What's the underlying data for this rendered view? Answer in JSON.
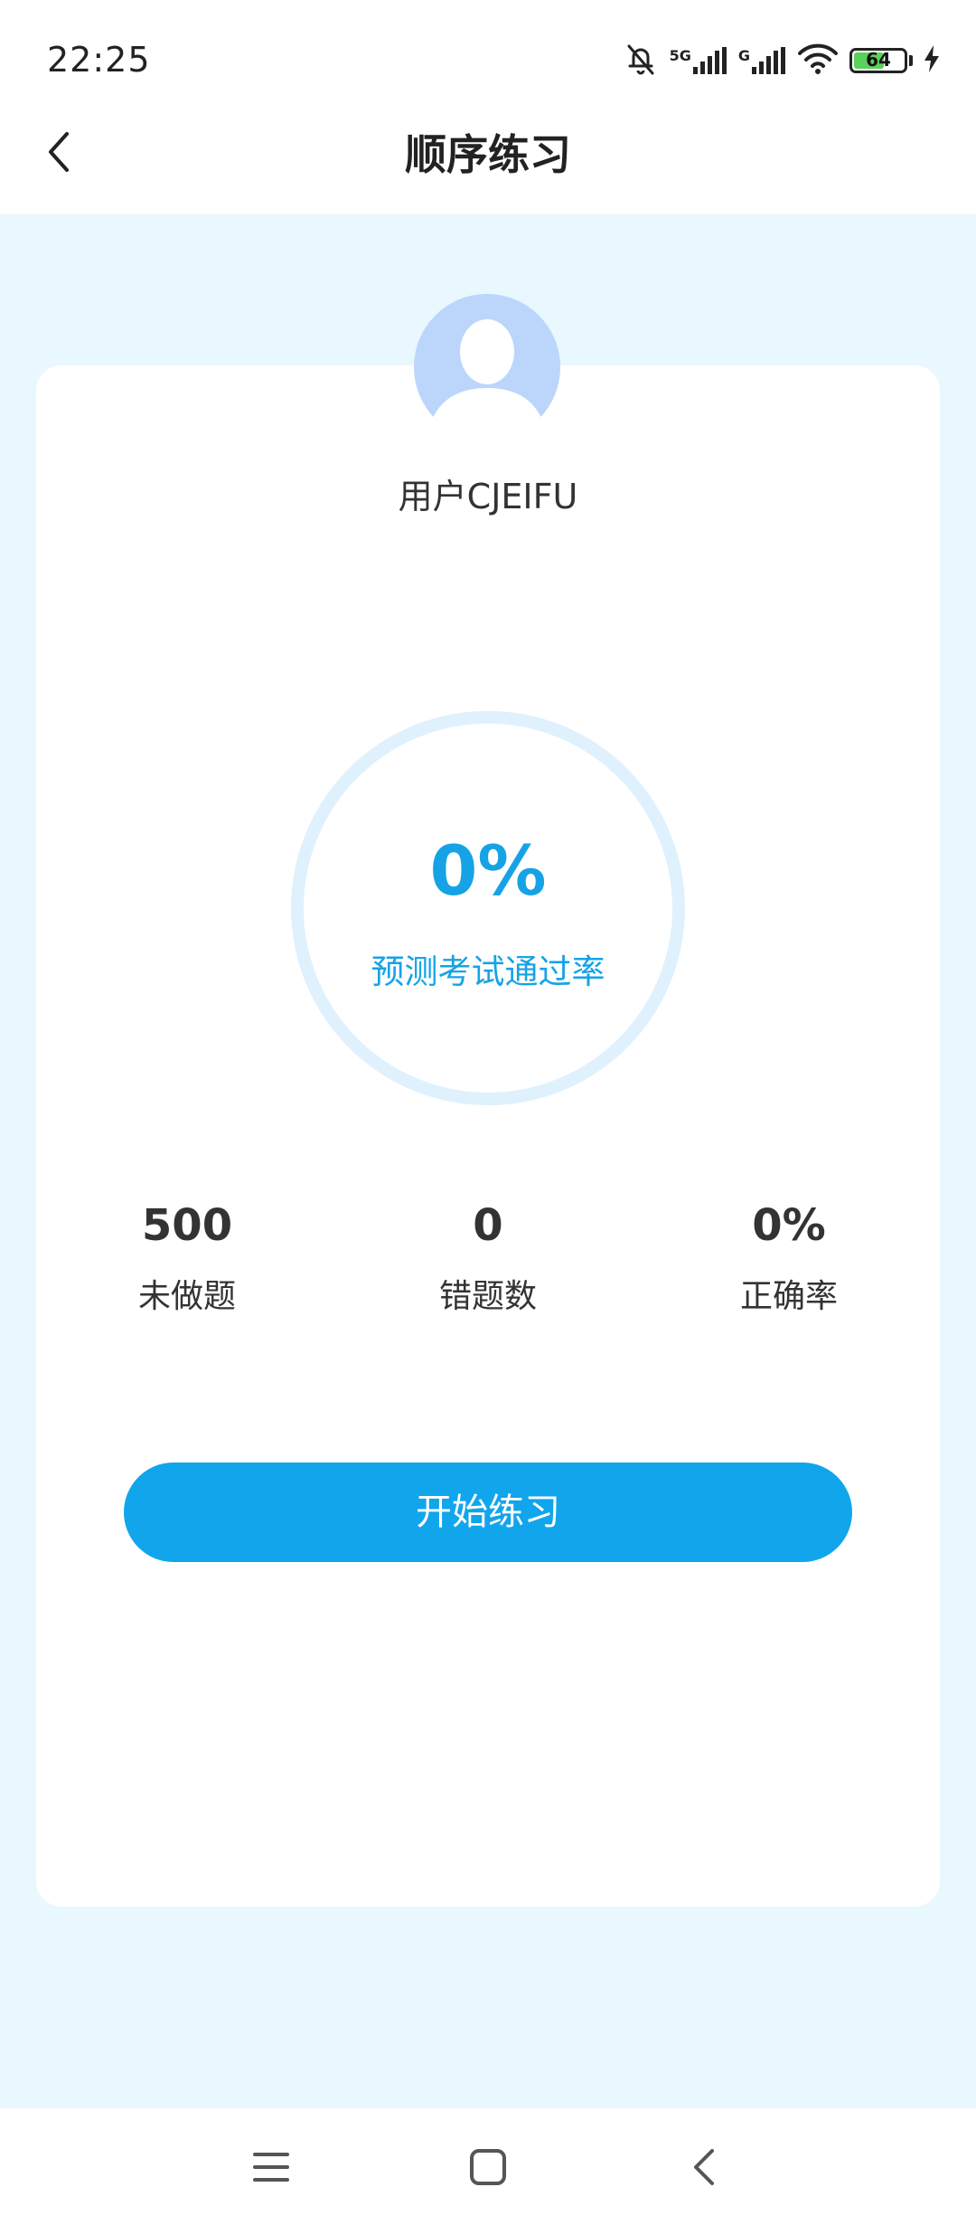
{
  "status_bar": {
    "time": "22:25",
    "network_5g_label": "5G",
    "network_g_label": "G",
    "battery_level": "64",
    "battery_fraction": 0.64
  },
  "header": {
    "title": "顺序练习"
  },
  "profile": {
    "username": "用户CJEIFU"
  },
  "gauge": {
    "value": "0%",
    "label": "预测考试通过率",
    "fraction": 0
  },
  "stats": [
    {
      "value": "500",
      "label": "未做题"
    },
    {
      "value": "0",
      "label": "错题数"
    },
    {
      "value": "0%",
      "label": "正确率"
    }
  ],
  "actions": {
    "start_label": "开始练习"
  },
  "colors": {
    "accent": "#11a5ec",
    "gauge_text": "#16a3e6",
    "gauge_track": "#dff1fd",
    "avatar_bg": "#bcd5fb",
    "page_bg": "#e9f7fe",
    "battery_fill": "#5bd05b"
  },
  "icons": {
    "back": "chevron-left-icon",
    "menu": "menu-icon",
    "home": "square-icon",
    "system_back": "chevron-left-icon"
  }
}
